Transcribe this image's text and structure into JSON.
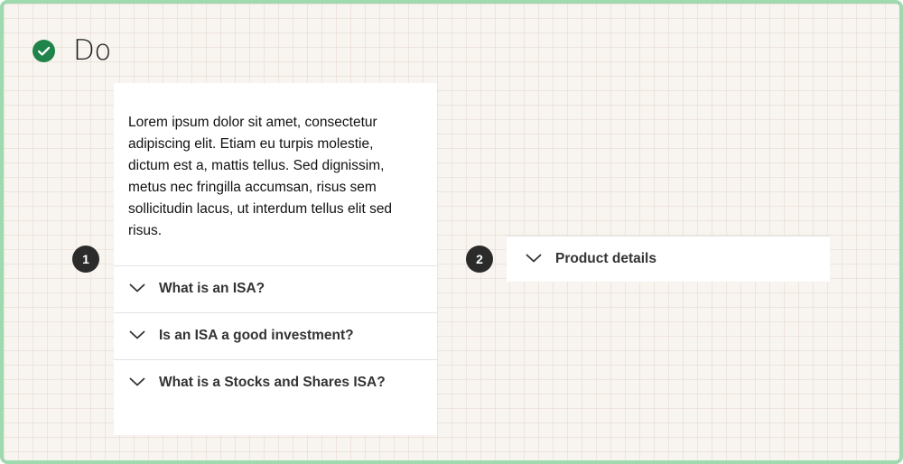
{
  "header": {
    "title": "Do",
    "icon": "check-circle-icon",
    "icon_color": "#1e8449"
  },
  "example1": {
    "badge": "1",
    "body_text": "Lorem ipsum dolor sit amet, consectetur adipiscing elit. Etiam eu turpis molestie, dictum est a, mattis tellus. Sed dignissim, metus nec fringilla accumsan, risus sem sollicitudin lacus, ut interdum tellus elit sed risus.",
    "items": [
      {
        "label": "What is an ISA?",
        "icon": "chevron-down-icon"
      },
      {
        "label": "Is an ISA a good investment?",
        "icon": "chevron-down-icon"
      },
      {
        "label": "What is a Stocks and Shares ISA?",
        "icon": "chevron-down-icon"
      }
    ]
  },
  "example2": {
    "badge": "2",
    "items": [
      {
        "label": "Product details",
        "icon": "chevron-down-icon"
      }
    ]
  },
  "colors": {
    "frame_border": "#9fd9ae",
    "background": "#f8f4ef",
    "badge": "#2b2b2b"
  }
}
